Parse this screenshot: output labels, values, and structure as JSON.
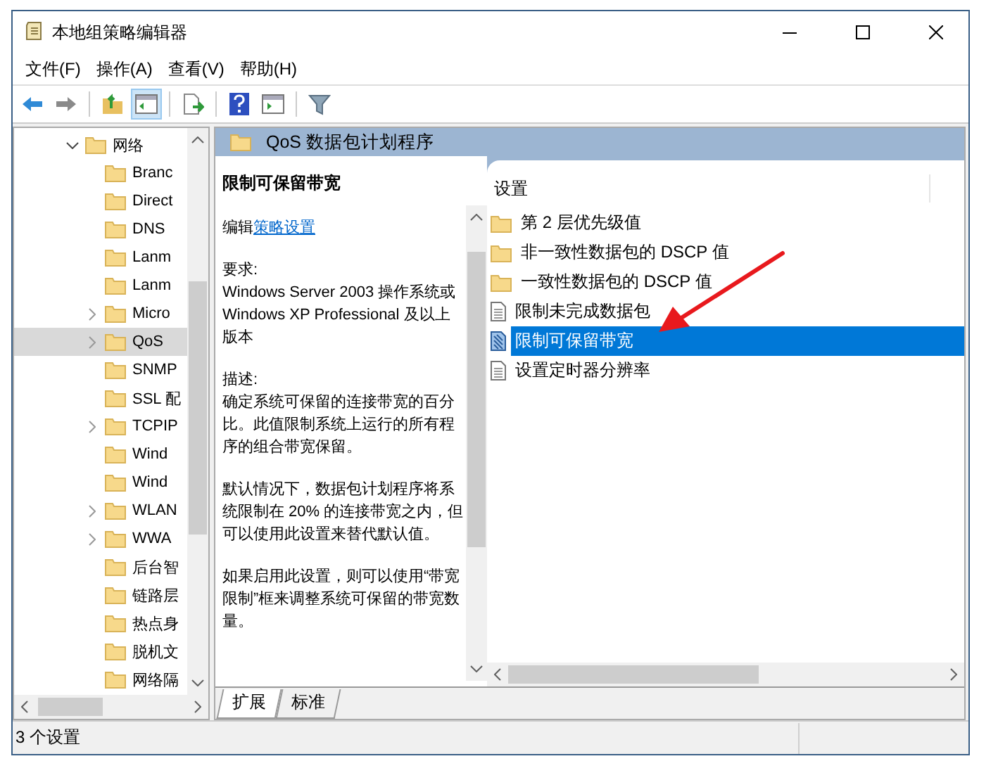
{
  "window": {
    "title": "本地组策略编辑器"
  },
  "menu": [
    "文件(F)",
    "操作(A)",
    "查看(V)",
    "帮助(H)"
  ],
  "tree": {
    "items": [
      {
        "label": "网络",
        "kind": "expandable",
        "expanded": true,
        "selected": false,
        "children": [
          {
            "label": "Branc",
            "kind": "leaf",
            "selected": false
          },
          {
            "label": "Direct",
            "kind": "leaf",
            "selected": false
          },
          {
            "label": "DNS",
            "kind": "leaf",
            "selected": false
          },
          {
            "label": "Lanm",
            "kind": "leaf",
            "selected": false
          },
          {
            "label": "Lanm",
            "kind": "leaf",
            "selected": false
          },
          {
            "label": "Micro",
            "kind": "expandable",
            "expanded": false,
            "selected": false
          },
          {
            "label": "QoS",
            "kind": "expandable",
            "expanded": false,
            "selected": true
          },
          {
            "label": "SNMP",
            "kind": "leaf",
            "selected": false
          },
          {
            "label": "SSL 配",
            "kind": "leaf",
            "selected": false
          },
          {
            "label": "TCPIP",
            "kind": "expandable",
            "expanded": false,
            "selected": false
          },
          {
            "label": "Wind",
            "kind": "leaf",
            "selected": false
          },
          {
            "label": "Wind",
            "kind": "leaf",
            "selected": false
          },
          {
            "label": "WLAN",
            "kind": "expandable",
            "expanded": false,
            "selected": false
          },
          {
            "label": "WWA",
            "kind": "expandable",
            "expanded": false,
            "selected": false
          },
          {
            "label": "后台智",
            "kind": "leaf",
            "selected": false
          },
          {
            "label": "链路层",
            "kind": "leaf",
            "selected": false
          },
          {
            "label": "热点身",
            "kind": "leaf",
            "selected": false
          },
          {
            "label": "脱机文",
            "kind": "leaf",
            "selected": false
          },
          {
            "label": "网络隔",
            "kind": "leaf",
            "selected": false
          }
        ]
      }
    ]
  },
  "header": {
    "title": "QoS 数据包计划程序"
  },
  "description": {
    "title": "限制可保留带宽",
    "edit_prefix": "编辑",
    "edit_link": "策略设置",
    "paragraphs": [
      [
        "要求:",
        "Windows Server 2003 操作系统或 Windows XP Professional 及以上版本"
      ],
      [
        "描述:",
        "确定系统可保留的连接带宽的百分比。此值限制系统上运行的所有程序的组合带宽保留。"
      ],
      [
        "默认情况下，数据包计划程序将系统限制在 20% 的连接带宽之内，但可以使用此设置来替代默认值。"
      ],
      [
        "如果启用此设置，则可以使用“带宽限制”框来调整系统可保留的带宽数量。"
      ]
    ]
  },
  "settings": {
    "column": "设置",
    "items": [
      {
        "label": "第 2 层优先级值",
        "kind": "folder",
        "selected": false
      },
      {
        "label": "非一致性数据包的 DSCP 值",
        "kind": "folder",
        "selected": false
      },
      {
        "label": "一致性数据包的 DSCP 值",
        "kind": "folder",
        "selected": false
      },
      {
        "label": "限制未完成数据包",
        "kind": "setting",
        "selected": false
      },
      {
        "label": "限制可保留带宽",
        "kind": "setting",
        "selected": true
      },
      {
        "label": "设置定时器分辨率",
        "kind": "setting",
        "selected": false
      }
    ]
  },
  "tabs": [
    {
      "label": "扩展",
      "selected": true
    },
    {
      "label": "标准",
      "selected": false
    }
  ],
  "status_bar": "3 个设置"
}
